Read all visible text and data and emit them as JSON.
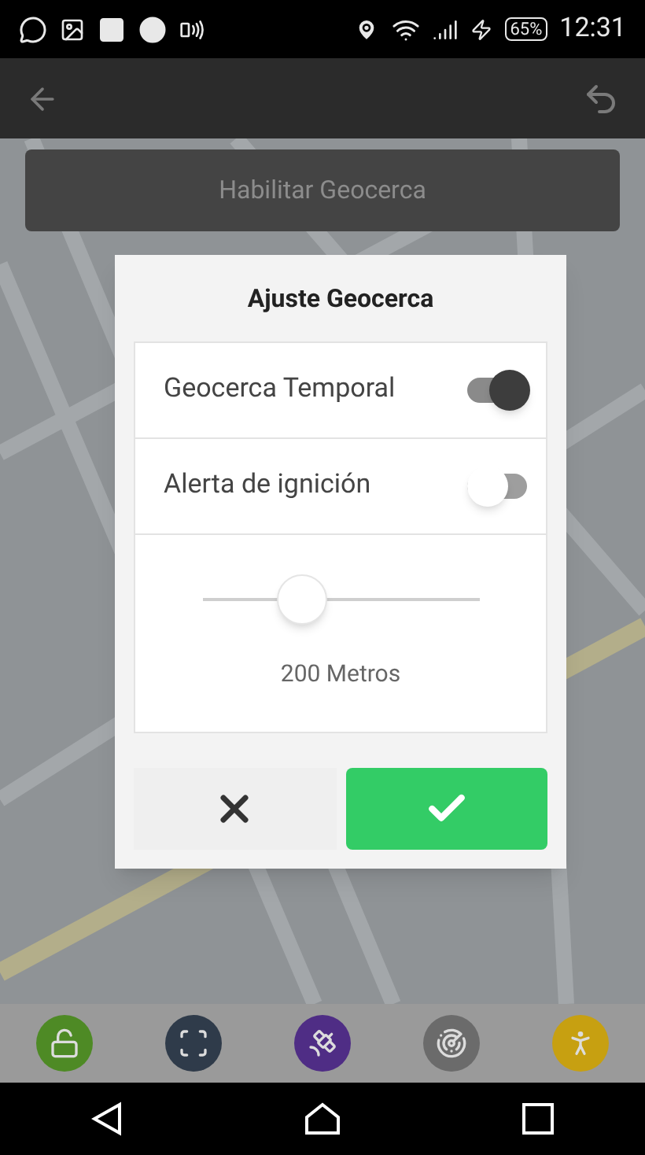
{
  "status_bar": {
    "battery": "65%",
    "time": "12:31"
  },
  "enable_button": {
    "label": "Habilitar Geocerca"
  },
  "dialog": {
    "title": "Ajuste Geocerca",
    "toggles": [
      {
        "label": "Geocerca Temporal",
        "on": true
      },
      {
        "label": "Alerta de ignición",
        "on": false
      }
    ],
    "radius": {
      "level": 0.36,
      "reading": "200 Metros"
    }
  },
  "toolbar": [
    {
      "kind": "unlock",
      "color": "#4e8a25"
    },
    {
      "kind": "focus",
      "color": "#2f3b4a"
    },
    {
      "kind": "satellite",
      "color": "#4f2d85"
    },
    {
      "kind": "radar",
      "color": "#6b6b6b"
    },
    {
      "kind": "person",
      "color": "#c7a011"
    }
  ]
}
